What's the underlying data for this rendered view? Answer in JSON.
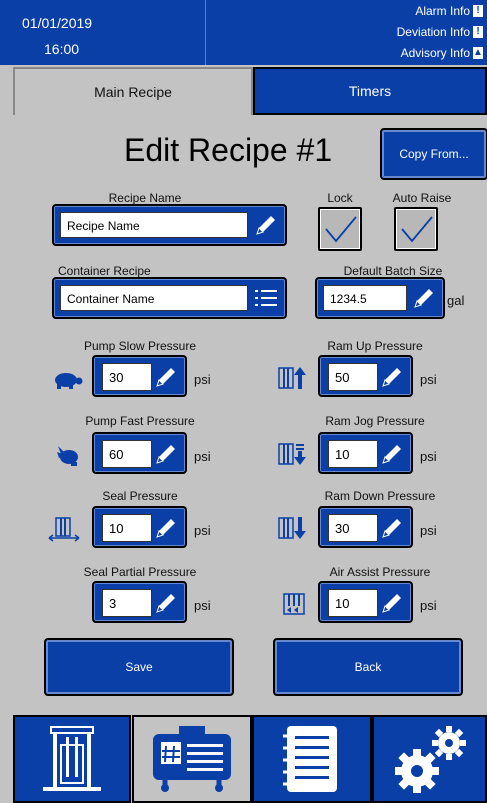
{
  "status": {
    "date": "01/01/2019",
    "time": "16:00",
    "alarm_info": "Alarm Info",
    "deviation_info": "Deviation Info",
    "advisory_info": "Advisory Info"
  },
  "tabs": [
    {
      "label": "Main Recipe",
      "active": true
    },
    {
      "label": "Timers",
      "active": false
    }
  ],
  "page_title": "Edit Recipe #1",
  "copy_from_label": "Copy From...",
  "recipe_name": {
    "label": "Recipe Name",
    "value": "Recipe Name"
  },
  "lock": {
    "label": "Lock",
    "checked": true
  },
  "auto_raise": {
    "label": "Auto Raise",
    "checked": true
  },
  "container_recipe": {
    "label": "Container Recipe",
    "value": "Container Name"
  },
  "batch_size": {
    "label": "Default Batch Size",
    "value": "1234.5",
    "unit": "gal"
  },
  "pump_slow": {
    "label": "Pump Slow Pressure",
    "value": "30",
    "unit": "psi"
  },
  "pump_fast": {
    "label": "Pump Fast Pressure",
    "value": "60",
    "unit": "psi"
  },
  "seal": {
    "label": "Seal Pressure",
    "value": "10",
    "unit": "psi"
  },
  "seal_partial": {
    "label": "Seal Partial Pressure",
    "value": "3",
    "unit": "psi"
  },
  "ram_up": {
    "label": "Ram Up Pressure",
    "value": "50",
    "unit": "psi"
  },
  "ram_jog": {
    "label": "Ram Jog Pressure",
    "value": "10",
    "unit": "psi"
  },
  "ram_down": {
    "label": "Ram Down Pressure",
    "value": "30",
    "unit": "psi"
  },
  "air_assist": {
    "label": "Air Assist Pressure",
    "value": "10",
    "unit": "psi"
  },
  "save_label": "Save",
  "back_label": "Back",
  "nav": [
    "ram-icon",
    "recipe-icon",
    "list-icon",
    "gears-icon"
  ],
  "colors": {
    "accent": "#0a3fa8",
    "panel": "#c3c3c3"
  }
}
